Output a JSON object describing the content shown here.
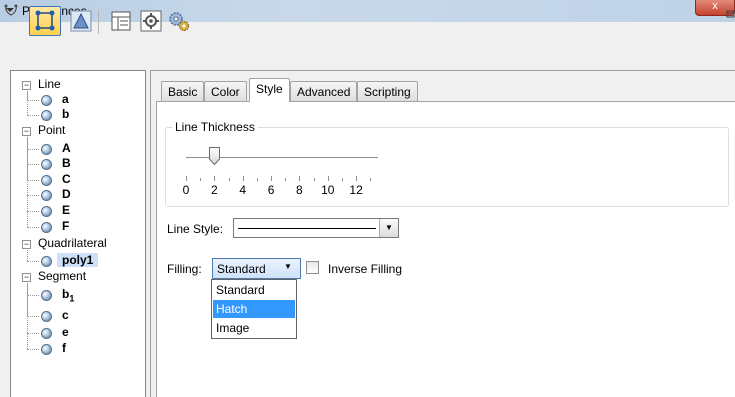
{
  "window": {
    "title": "Preferences",
    "close_glyph": "x"
  },
  "toolbar": {
    "buttons": [
      {
        "name": "select-objects",
        "icon": "select-object-icon"
      },
      {
        "name": "graphics",
        "icon": "graphics-icon"
      },
      {
        "name": "layout",
        "icon": "layout-icon"
      },
      {
        "name": "defaults",
        "icon": "defaults-icon"
      },
      {
        "name": "settings",
        "icon": "settings-gear-icon"
      }
    ]
  },
  "tree": [
    {
      "label": "Line",
      "type": "group",
      "expander": "−"
    },
    {
      "label": "a",
      "type": "leaf"
    },
    {
      "label": "b",
      "type": "leaf"
    },
    {
      "label": "Point",
      "type": "group",
      "expander": "−"
    },
    {
      "label": "A",
      "type": "leaf"
    },
    {
      "label": "B",
      "type": "leaf"
    },
    {
      "label": "C",
      "type": "leaf"
    },
    {
      "label": "D",
      "type": "leaf"
    },
    {
      "label": "E",
      "type": "leaf"
    },
    {
      "label": "F",
      "type": "leaf"
    },
    {
      "label": "Quadrilateral",
      "type": "group",
      "expander": "−"
    },
    {
      "label": "poly1",
      "type": "leaf",
      "selected": true
    },
    {
      "label": "Segment",
      "type": "group",
      "expander": "−"
    },
    {
      "label": "b",
      "subscript": "1",
      "type": "leaf"
    },
    {
      "label": "c",
      "type": "leaf"
    },
    {
      "label": "e",
      "type": "leaf"
    },
    {
      "label": "f",
      "type": "leaf"
    }
  ],
  "tabs": [
    {
      "label": "Basic"
    },
    {
      "label": "Color"
    },
    {
      "label": "Style",
      "active": true
    },
    {
      "label": "Advanced"
    },
    {
      "label": "Scripting"
    }
  ],
  "style": {
    "thickness_label": "Line Thickness",
    "thickness_value": 2,
    "thickness_min": 0,
    "thickness_max": 13,
    "tick_labels": [
      "0",
      "2",
      "4",
      "6",
      "8",
      "10",
      "12"
    ],
    "line_style_label": "Line Style:",
    "filling_label": "Filling:",
    "filling_value": "Standard",
    "filling_options": [
      "Standard",
      "Hatch",
      "Image"
    ],
    "filling_highlighted": "Hatch",
    "inverse_label": "Inverse Filling",
    "inverse_checked": false
  },
  "colors": {
    "accent": "#3399ff",
    "selection_bg": "#cde0f7"
  }
}
